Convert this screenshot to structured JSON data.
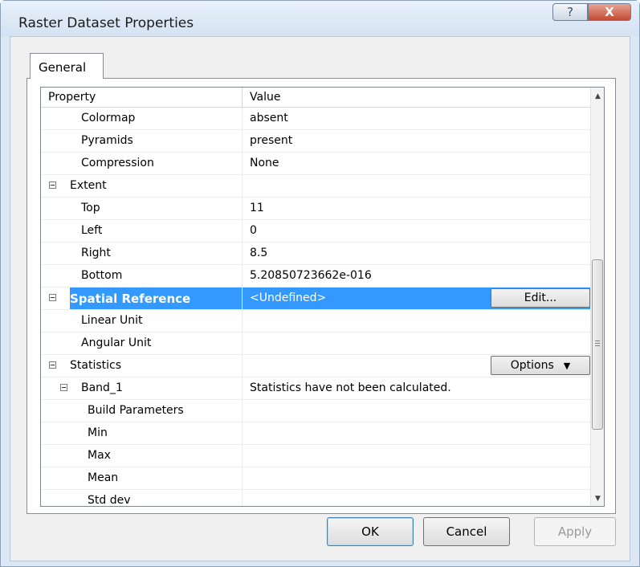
{
  "window": {
    "title": "Raster Dataset Properties",
    "help_label": "?",
    "close_label": "X"
  },
  "tabs": [
    {
      "label": "General",
      "selected": true
    }
  ],
  "grid": {
    "columns": [
      "Property",
      "Value"
    ],
    "rows": [
      {
        "name": "Colormap",
        "value": "absent",
        "level": 1
      },
      {
        "name": "Pyramids",
        "value": "present",
        "level": 1
      },
      {
        "name": "Compression",
        "value": "None",
        "level": 1
      },
      {
        "name": "Extent",
        "value": "",
        "level": 0,
        "expander": "collapse"
      },
      {
        "name": "Top",
        "value": "11",
        "level": 1
      },
      {
        "name": "Left",
        "value": "0",
        "level": 1
      },
      {
        "name": "Right",
        "value": "8.5",
        "level": 1
      },
      {
        "name": "Bottom",
        "value": "5.20850723662e-016",
        "level": 1
      },
      {
        "name": "Spatial Reference",
        "value": "<Undefined>",
        "level": 0,
        "expander": "collapse",
        "selected": true,
        "button": "Edit..."
      },
      {
        "name": "Linear Unit",
        "value": "",
        "level": 1
      },
      {
        "name": "Angular Unit",
        "value": "",
        "level": 1
      },
      {
        "name": "Statistics",
        "value": "",
        "level": 0,
        "expander": "collapse",
        "button": "Options"
      },
      {
        "name": "Band_1",
        "value": "Statistics have not been calculated.",
        "level": 1,
        "expander": "collapse"
      },
      {
        "name": "Build Parameters",
        "value": "",
        "level": 2
      },
      {
        "name": "Min",
        "value": "",
        "level": 2
      },
      {
        "name": "Max",
        "value": "",
        "level": 2
      },
      {
        "name": "Mean",
        "value": "",
        "level": 2
      },
      {
        "name": "Std dev",
        "value": "",
        "level": 2
      }
    ]
  },
  "buttons": {
    "ok": "OK",
    "cancel": "Cancel",
    "apply": "Apply",
    "apply_enabled": false
  },
  "colors": {
    "selection": "#3399ff",
    "title_bar": "#dbe7f4",
    "close_button": "#c24a34"
  },
  "icons": {
    "scroll_up": "scroll-up-arrow-icon",
    "scroll_down": "scroll-down-arrow-icon",
    "dropdown": "dropdown-arrow-icon",
    "collapse": "collapse-box-icon"
  }
}
